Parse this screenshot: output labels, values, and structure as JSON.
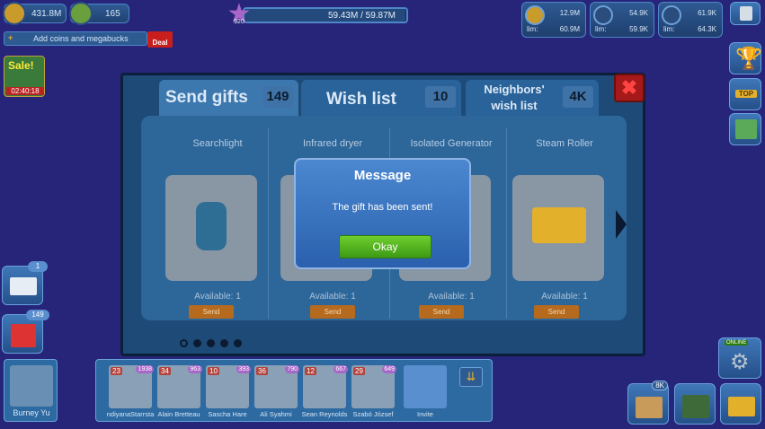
{
  "top_bar": {
    "coins": "431.8M",
    "megabucks": "165",
    "level": "920",
    "xp_progress": "59.43M / 59.87M",
    "xp_fraction": 0.993,
    "add_coins_label": "Add coins and megabucks",
    "deal_badge": "Deal"
  },
  "resources": [
    {
      "icon": "population-icon",
      "value": "12.9M",
      "limit_label": "lim:",
      "limit": "60.9M"
    },
    {
      "icon": "water-icon",
      "value": "54.9K",
      "limit_label": "lim:",
      "limit": "59.9K"
    },
    {
      "icon": "power-icon",
      "value": "61.9K",
      "limit_label": "lim:",
      "limit": "64.3K"
    }
  ],
  "sale": {
    "label": "Sale!",
    "timer": "02:40:18"
  },
  "tabs": [
    {
      "label": "Send gifts",
      "count": "149"
    },
    {
      "label": "Wish list",
      "count": "10"
    },
    {
      "label": "Neighbors' wish list",
      "count": "4K"
    }
  ],
  "gifts": [
    {
      "name": "Searchlight",
      "available": "Available: 1",
      "send": "Send"
    },
    {
      "name": "Infrared dryer",
      "available": "Available: 1",
      "send": "Send"
    },
    {
      "name": "Isolated Generator",
      "available": "Available: 1",
      "send": "Send"
    },
    {
      "name": "Steam Roller",
      "available": "Available: 1",
      "send": "Send"
    }
  ],
  "message": {
    "title": "Message",
    "body": "The gift has been sent!",
    "ok": "Okay"
  },
  "left_side": {
    "mail_count": "1",
    "gift_count": "149"
  },
  "player": {
    "name": "Burney Yu"
  },
  "friends": [
    {
      "level": "23",
      "stars": "1938",
      "name": "ndiyanaStarrsta"
    },
    {
      "level": "34",
      "stars": "963",
      "name": "Alain Bretteau"
    },
    {
      "level": "10",
      "stars": "393",
      "name": "Sascha Hare"
    },
    {
      "level": "36",
      "stars": "790",
      "name": "Ali Syahmi"
    },
    {
      "level": "12",
      "stars": "667",
      "name": "Sean Reynolds"
    },
    {
      "level": "29",
      "stars": "649",
      "name": "Szabó József"
    }
  ],
  "invite_label": "Invite",
  "right_bottom": {
    "online_label": "ONLINE",
    "shop_badge": "8K"
  },
  "top_label": "TOP"
}
